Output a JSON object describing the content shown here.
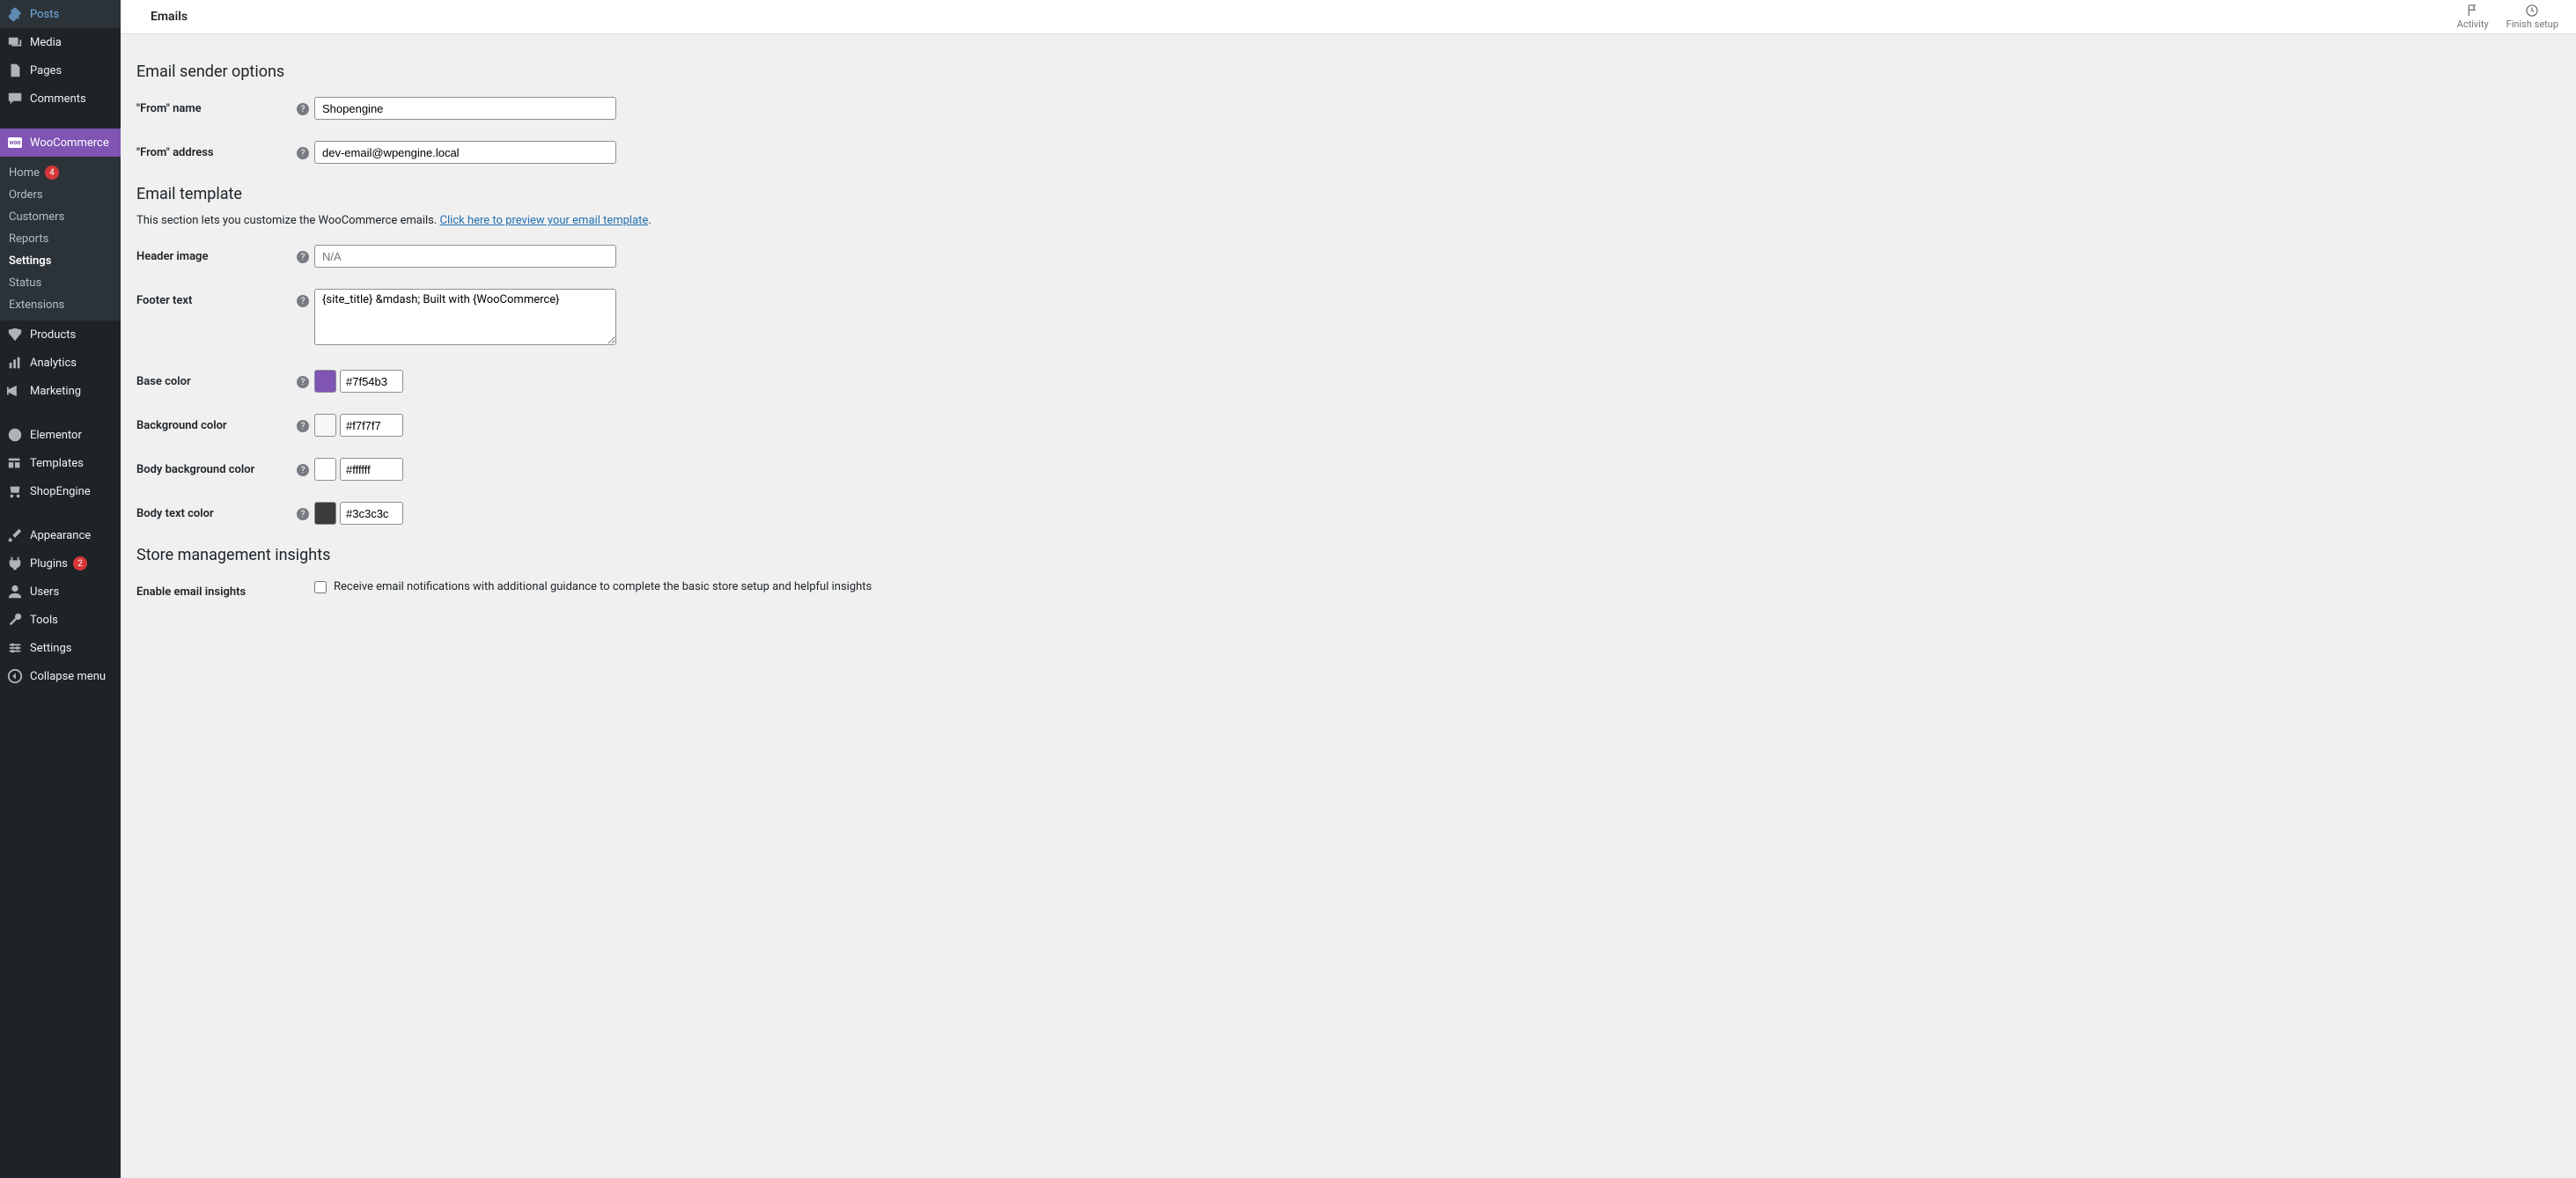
{
  "topbar": {
    "title": "Emails",
    "activity_label": "Activity",
    "finish_setup_label": "Finish setup"
  },
  "sidebar": {
    "posts": "Posts",
    "media": "Media",
    "pages": "Pages",
    "comments": "Comments",
    "woocommerce": "WooCommerce",
    "products": "Products",
    "analytics": "Analytics",
    "marketing": "Marketing",
    "elementor": "Elementor",
    "templates": "Templates",
    "shopengine": "ShopEngine",
    "appearance": "Appearance",
    "plugins": "Plugins",
    "plugins_count": "2",
    "users": "Users",
    "tools": "Tools",
    "settings": "Settings",
    "collapse": "Collapse menu",
    "submenu": {
      "home": "Home",
      "home_count": "4",
      "orders": "Orders",
      "customers": "Customers",
      "reports": "Reports",
      "settings": "Settings",
      "status": "Status",
      "extensions": "Extensions"
    }
  },
  "sections": {
    "sender": "Email sender options",
    "template": "Email template",
    "template_desc_pre": "This section lets you customize the WooCommerce emails. ",
    "template_desc_link": "Click here to preview your email template",
    "insights": "Store management insights"
  },
  "fields": {
    "from_name": {
      "label": "\"From\" name",
      "value": "Shopengine"
    },
    "from_address": {
      "label": "\"From\" address",
      "value": "dev-email@wpengine.local"
    },
    "header_image": {
      "label": "Header image",
      "placeholder": "N/A",
      "value": ""
    },
    "footer_text": {
      "label": "Footer text",
      "value": "{site_title} &mdash; Built with {WooCommerce}"
    },
    "base_color": {
      "label": "Base color",
      "value": "#7f54b3"
    },
    "background_color": {
      "label": "Background color",
      "value": "#f7f7f7"
    },
    "body_background_color": {
      "label": "Body background color",
      "value": "#ffffff"
    },
    "body_text_color": {
      "label": "Body text color",
      "value": "#3c3c3c"
    },
    "enable_insights": {
      "label": "Enable email insights",
      "checkbox_label": "Receive email notifications with additional guidance to complete the basic store setup and helpful insights"
    }
  }
}
